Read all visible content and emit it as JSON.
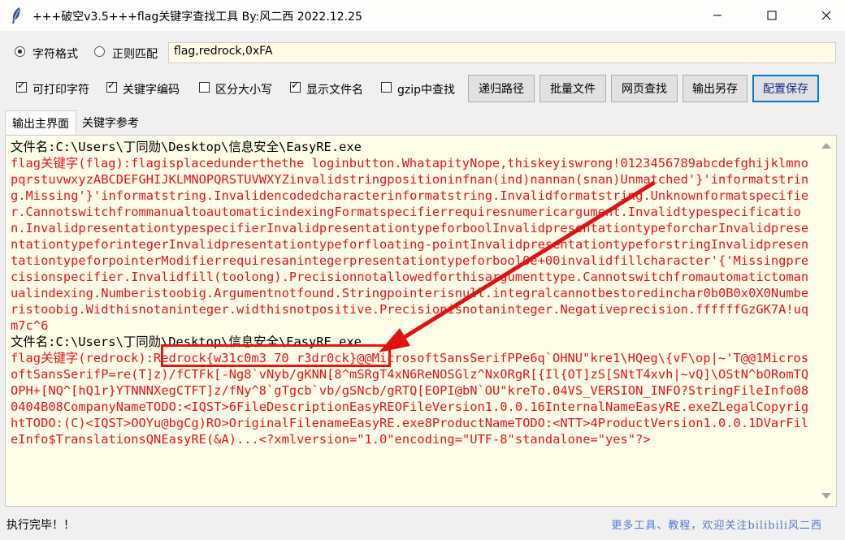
{
  "window": {
    "title": "+++破空v3.5+++flag关键字查找工具  By:风二西 2022.12.25",
    "icon": "feather-icon",
    "controls": [
      "minimize",
      "maximize",
      "close"
    ]
  },
  "mode": {
    "options": [
      {
        "label": "字符格式",
        "selected": true
      },
      {
        "label": "正则匹配",
        "selected": false
      }
    ]
  },
  "search": {
    "value": "flag,redrock,0xFA"
  },
  "options": [
    {
      "label": "可打印字符",
      "checked": true
    },
    {
      "label": "关键字编码",
      "checked": true
    },
    {
      "label": "区分大小写",
      "checked": false
    },
    {
      "label": "显示文件名",
      "checked": true
    },
    {
      "label": "gzip中查找",
      "checked": false
    }
  ],
  "buttons": {
    "recursive": "递归路径",
    "batch": "批量文件",
    "web_search": "网页查找",
    "export": "输出另存",
    "save_config": "配置保存"
  },
  "tabs": [
    {
      "label": "输出主界面",
      "active": true
    },
    {
      "label": "关键字参考",
      "active": false
    }
  ],
  "output": {
    "file1": "文件名:C:\\Users\\丁同勋\\Desktop\\信息安全\\EasyRE.exe",
    "result1": "flag关键字(flag):flagisplacedunderthethe loginbutton.WhatapityNope,thiskeyiswrong!0123456789abcdefghijklmnopqrstuvwxyzABCDEFGHIJKLMNOPQRSTUVWXYZinvalidstringpositioninfnan(ind)nannan(snan)Unmatched'}'informatstring.Missing'}'informatstring.Invalidencodedcharacterinformatstring.Invalidformatstring.Unknownformatspecifier.CannotswitchfrommanualtoautomaticindexingFormatspecifierrequiresnumericargument.Invalidtypespecification.InvalidpresentationtypespecifierInvalidpresentationtypeforboolInvalidpresentationtypeforcharInvalidpresentationtypeforintegerInvalidpresentationtypeforfloating-pointInvalidpresentationtypeforstringInvalidpresentationtypeforpointerModifierrequiresanintegerpresentationtypeforbool0e+00invalidfillcharacter'{'Missingprecisionspecifier.Invalidfill(toolong).Precisionnotallowedforthisargumenttype.Cannotswitchfromautomatictomanualindexing.Numberistoobig.Argumentnotfound.Stringpointerisnull.integralcannotbestoredinchar0b0B0x0X0Numberistoobig.Widthisnotaninteger.widthisnotpositive.Precisionisnotaninteger.Negativeprecision.ffffffGzGK7A!uqm7c^6",
    "file2": "文件名:C:\\Users\\丁同勋\\Desktop\\信息安全\\EasyRE.exe",
    "result2_prefix": "flag关键字(redrock)",
    "result2_match": ":Redrock{w31c0m3_70_r3dr0ck}",
    "result2_rest": "@@MicrosoftSansSerifPPe6q`OHNU\"kre1\\HQeg\\{vF\\op|~'T@@1MicrosoftSansSerifP=re(T]z)/fCTFk[-Ng8`vNyb/gKNN[8^mSRgT4xN6ReNOSGlz^NxORgR[{Il{OT]zS[SNtT4xvh|~vQ]\\OStN^bORomTQOPH+[NQ^[hQ1r}YTNNNXegCTFT]z/fNy^8`gTgcb`vb/gSNcb/gRTQ[EOPI@bN`OU\"kreTo.04VS_VERSION_INFO?StringFileInfo080404B08CompanyNameTODO:<IQST>6FileDescriptionEasyREOFileVersion1.0.0.16InternalNameEasyRE.exeZLegalCopyrightTODO:(C)<IQST>OOYu@bgCg)RO>OriginalFilenameEasyRE.exe8ProductNameTODO:<NTT>4ProductVersion1.0.0.1DVarFileInfo$TranslationsQNEasyRE(&A)...<?xmlversion=\"1.0\"encoding=\"UTF-8\"standalone=\"yes\"?>"
  },
  "status": {
    "left": "执行完毕！！",
    "right": "更多工具、教程，欢迎关注bilibili风二西"
  },
  "colors": {
    "match_text": "#e8111b",
    "panel_bg": "#fefde8",
    "annotation": "#e11111"
  }
}
